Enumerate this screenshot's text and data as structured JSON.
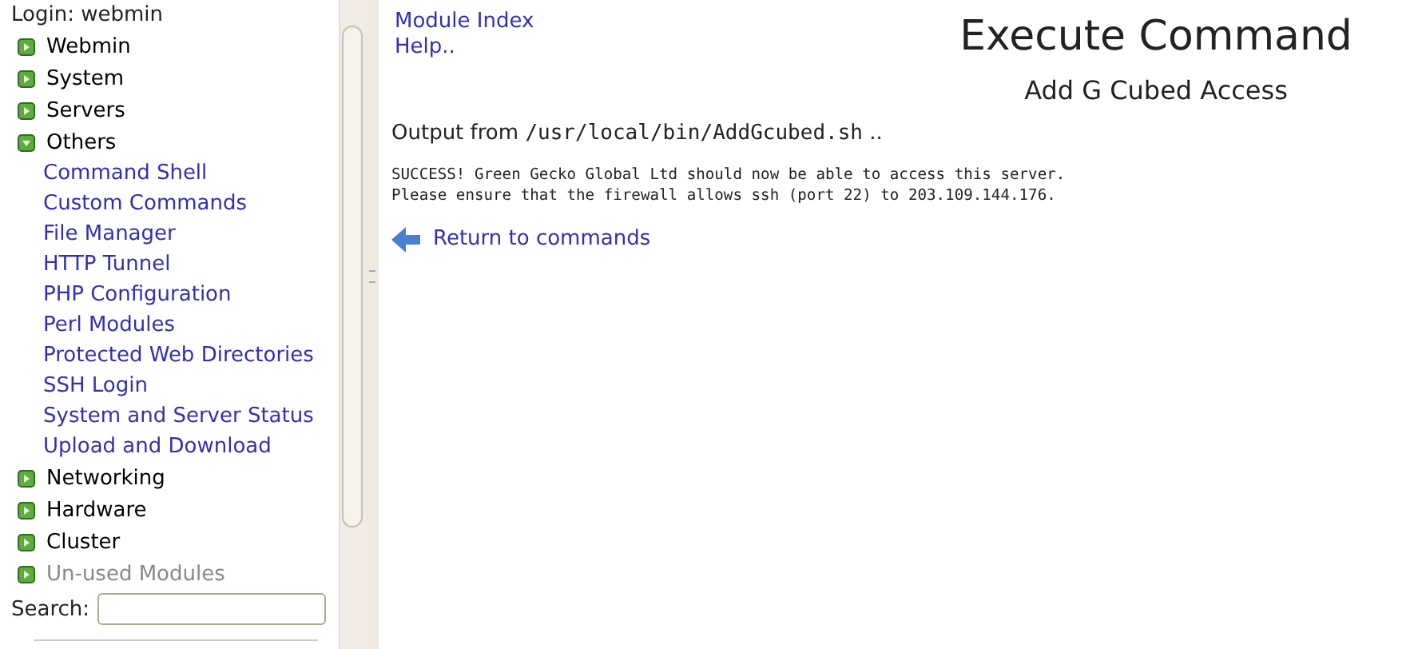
{
  "sidebar": {
    "login": "Login: webmin",
    "categories": [
      {
        "label": "Webmin",
        "expanded": false,
        "disabled": false
      },
      {
        "label": "System",
        "expanded": false,
        "disabled": false
      },
      {
        "label": "Servers",
        "expanded": false,
        "disabled": false
      },
      {
        "label": "Others",
        "expanded": true,
        "disabled": false,
        "children": [
          "Command Shell",
          "Custom Commands",
          "File Manager",
          "HTTP Tunnel",
          "PHP Configuration",
          "Perl Modules",
          "Protected Web Directories",
          "SSH Login",
          "System and Server Status",
          "Upload and Download"
        ]
      },
      {
        "label": "Networking",
        "expanded": false,
        "disabled": false
      },
      {
        "label": "Hardware",
        "expanded": false,
        "disabled": false
      },
      {
        "label": "Cluster",
        "expanded": false,
        "disabled": false
      },
      {
        "label": "Un-used Modules",
        "expanded": false,
        "disabled": true
      }
    ],
    "search_label": "Search:"
  },
  "main": {
    "links": [
      "Module Index",
      "Help.."
    ],
    "title": "Execute Command",
    "subtitle": "Add G Cubed Access",
    "output_prefix": "Output from ",
    "output_path": "/usr/local/bin/AddGcubed.sh",
    "output_suffix": " ..",
    "output_lines": [
      "SUCCESS! Green Gecko Global Ltd should now be able to access this server.",
      "Please ensure that the firewall allows ssh (port 22) to 203.109.144.176."
    ],
    "return_link": "Return to commands"
  }
}
